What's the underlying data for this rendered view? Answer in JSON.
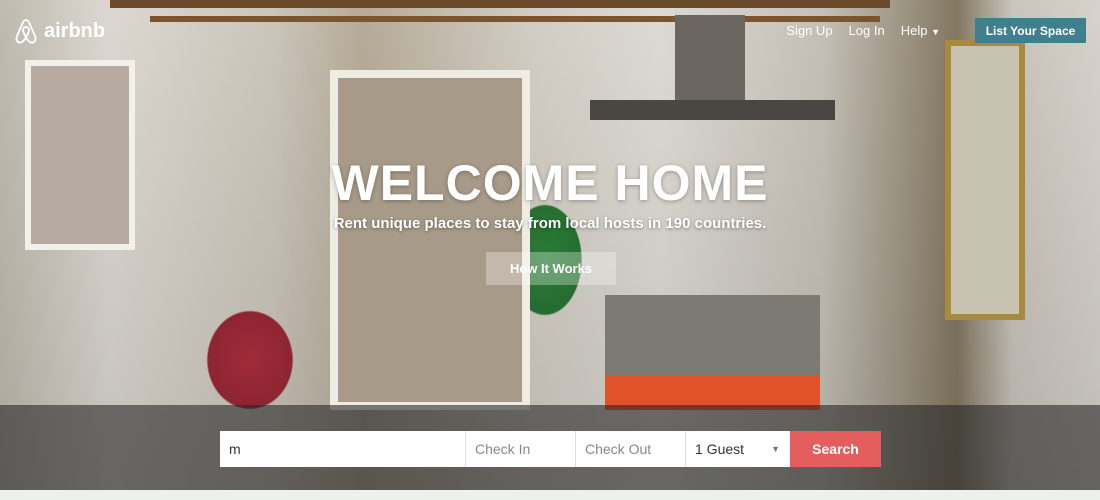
{
  "nav": {
    "brand": "airbnb",
    "links": [
      "Sign Up",
      "Log In",
      "Help"
    ],
    "list_space": "List Your Space"
  },
  "hero": {
    "title": "WELCOME HOME",
    "subtitle": "Rent unique places to stay from local hosts in 190 countries.",
    "how_it_works": "How It Works"
  },
  "search": {
    "location_value": "m",
    "check_in_placeholder": "Check In",
    "check_out_placeholder": "Check Out",
    "guests_value": "1 Guest",
    "search_label": "Search"
  },
  "colors": {
    "accent": "#e55e5e",
    "list_button": "#3f7f8f"
  }
}
